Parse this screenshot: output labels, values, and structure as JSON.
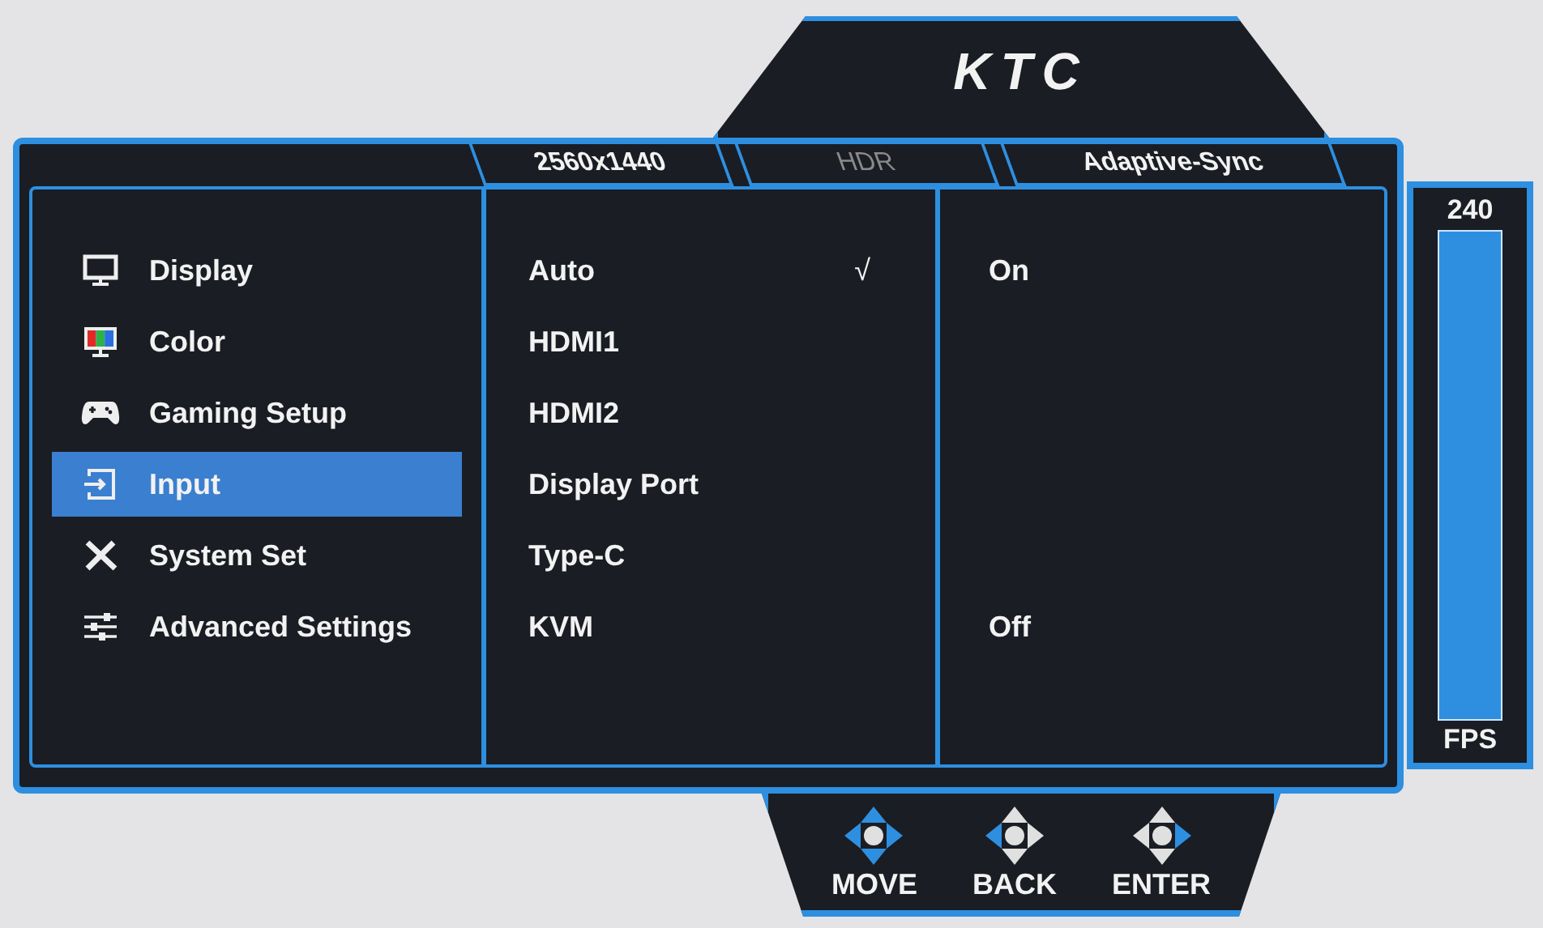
{
  "logo": "KTC",
  "tabs": [
    {
      "label": "2560x1440",
      "disabled": false
    },
    {
      "label": "HDR",
      "disabled": true
    },
    {
      "label": "Adaptive-Sync",
      "disabled": false
    }
  ],
  "sidebar": {
    "items": [
      {
        "label": "Display",
        "selected": false
      },
      {
        "label": "Color",
        "selected": false
      },
      {
        "label": "Gaming Setup",
        "selected": false
      },
      {
        "label": "Input",
        "selected": true
      },
      {
        "label": "System Set",
        "selected": false
      },
      {
        "label": "Advanced Settings",
        "selected": false
      }
    ]
  },
  "options": [
    {
      "label": "Auto",
      "check": "√",
      "value": "On"
    },
    {
      "label": "HDMI1"
    },
    {
      "label": "HDMI2"
    },
    {
      "label": "Display Port"
    },
    {
      "label": "Type-C"
    },
    {
      "label": "KVM",
      "value": "Off"
    }
  ],
  "fps_meter": {
    "reading": "240",
    "unit": "FPS",
    "level": 1
  },
  "nav": [
    {
      "label": "MOVE",
      "kind": "move"
    },
    {
      "label": "BACK",
      "kind": "back"
    },
    {
      "label": "ENTER",
      "kind": "enter"
    }
  ]
}
